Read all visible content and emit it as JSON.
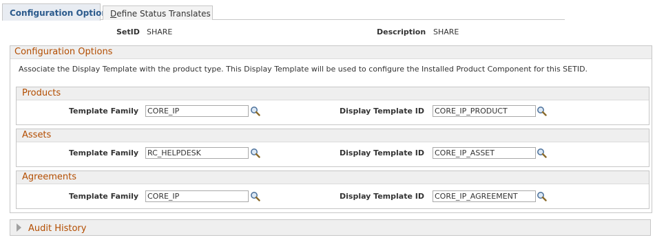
{
  "tabs": [
    {
      "label": "Configuration Options",
      "active": true
    },
    {
      "label_prefix": "D",
      "label_rest": "efine Status Translates",
      "active": false
    }
  ],
  "header": {
    "setid_label": "SetID",
    "setid_value": "SHARE",
    "description_label": "Description",
    "description_value": "SHARE"
  },
  "config": {
    "title": "Configuration Options",
    "description": "Associate the Display Template with the product type. This Display Template will be used to configure the Installed Product Component for this SETID.",
    "template_family_label": "Template Family",
    "display_template_label": "Display Template ID",
    "sections": [
      {
        "title": "Products",
        "template_family": "CORE_IP",
        "display_template_id": "CORE_IP_PRODUCT"
      },
      {
        "title": "Assets",
        "template_family": "RC_HELPDESK",
        "display_template_id": "CORE_IP_ASSET"
      },
      {
        "title": "Agreements",
        "template_family": "CORE_IP",
        "display_template_id": "CORE_IP_AGREEMENT"
      }
    ]
  },
  "audit": {
    "label": "Audit History"
  },
  "colors": {
    "section_title": "#b34d00",
    "tab_active_text": "#2b5a8c"
  }
}
